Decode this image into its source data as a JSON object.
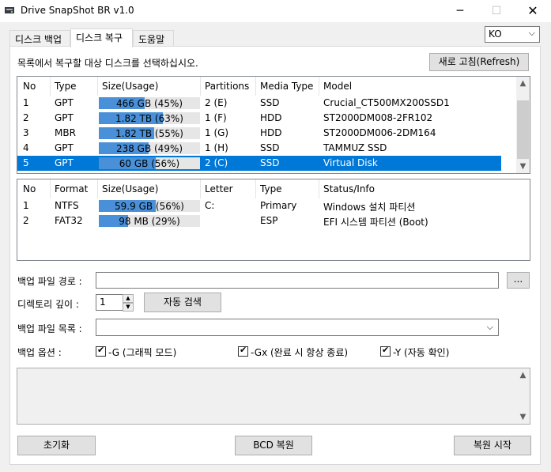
{
  "window": {
    "title": "Drive SnapShot BR v1.0",
    "minimize": "─",
    "maximize": "☐",
    "close": "✕"
  },
  "tabs": [
    {
      "label": "디스크 백업"
    },
    {
      "label": "디스크 복구"
    },
    {
      "label": "도움말"
    }
  ],
  "language": {
    "selected": "KO"
  },
  "instruction": "목록에서 복구할 대상 디스크를 선택하십시오.",
  "refresh_label": "새로 고침(Refresh)",
  "disk_list": {
    "headers": [
      "No",
      "Type",
      "Size(Usage)",
      "Partitions",
      "Media Type",
      "Model"
    ],
    "rows": [
      {
        "no": "1",
        "type": "GPT",
        "size": "466 GB (45%)",
        "usage": 0.45,
        "partitions": "2 (E)",
        "media": "SSD",
        "model": "Crucial_CT500MX200SSD1",
        "selected": false
      },
      {
        "no": "2",
        "type": "GPT",
        "size": "1.82 TB (63%)",
        "usage": 0.63,
        "partitions": "1 (F)",
        "media": "HDD",
        "model": "ST2000DM008-2FR102",
        "selected": false
      },
      {
        "no": "3",
        "type": "MBR",
        "size": "1.82 TB (55%)",
        "usage": 0.55,
        "partitions": "1 (G)",
        "media": "HDD",
        "model": "ST2000DM006-2DM164",
        "selected": false
      },
      {
        "no": "4",
        "type": "GPT",
        "size": "238 GB (49%)",
        "usage": 0.49,
        "partitions": "1 (H)",
        "media": "SSD",
        "model": "TAMMUZ SSD",
        "selected": false
      },
      {
        "no": "5",
        "type": "GPT",
        "size": "60 GB (56%)",
        "usage": 0.56,
        "partitions": "2 (C)",
        "media": "SSD",
        "model": "Virtual Disk",
        "selected": true
      }
    ]
  },
  "partition_list": {
    "headers": [
      "No",
      "Format",
      "Size(Usage)",
      "Letter",
      "Type",
      "Status/Info"
    ],
    "rows": [
      {
        "no": "1",
        "format": "NTFS",
        "size": "59.9 GB (56%)",
        "usage": 0.56,
        "letter": "C:",
        "type": "Primary",
        "info": "Windows 설치 파티션"
      },
      {
        "no": "2",
        "format": "FAT32",
        "size": "98 MB (29%)",
        "usage": 0.29,
        "letter": "",
        "type": "ESP",
        "info": "EFI 시스템 파티션 (Boot)"
      }
    ]
  },
  "form": {
    "backup_path_label": "백업 파일 경로 :",
    "backup_path_value": "",
    "browse_label": "...",
    "dir_depth_label": "디렉토리 깊이 :",
    "dir_depth_value": "1",
    "auto_search_label": "자동 검색",
    "backup_list_label": "백업 파일 목록 :",
    "backup_list_value": "",
    "options_label": "백업 옵션 :",
    "options": [
      {
        "label": "-G (그래픽 모드)",
        "checked": true
      },
      {
        "label": "-Gx (완료 시 항상 종료)",
        "checked": true
      },
      {
        "label": "-Y (자동 확인)",
        "checked": true
      }
    ]
  },
  "log": "",
  "buttons": {
    "init": "초기화",
    "bcd": "BCD 복원",
    "start": "복원 시작"
  },
  "colors": {
    "selection": "#0078d7",
    "usage_bar": "#4a90d9"
  },
  "icons": {
    "app": "drive-icon",
    "chevron": "chevron-down-icon",
    "scroll_up": "scroll-up-icon",
    "scroll_down": "scroll-down-icon"
  }
}
